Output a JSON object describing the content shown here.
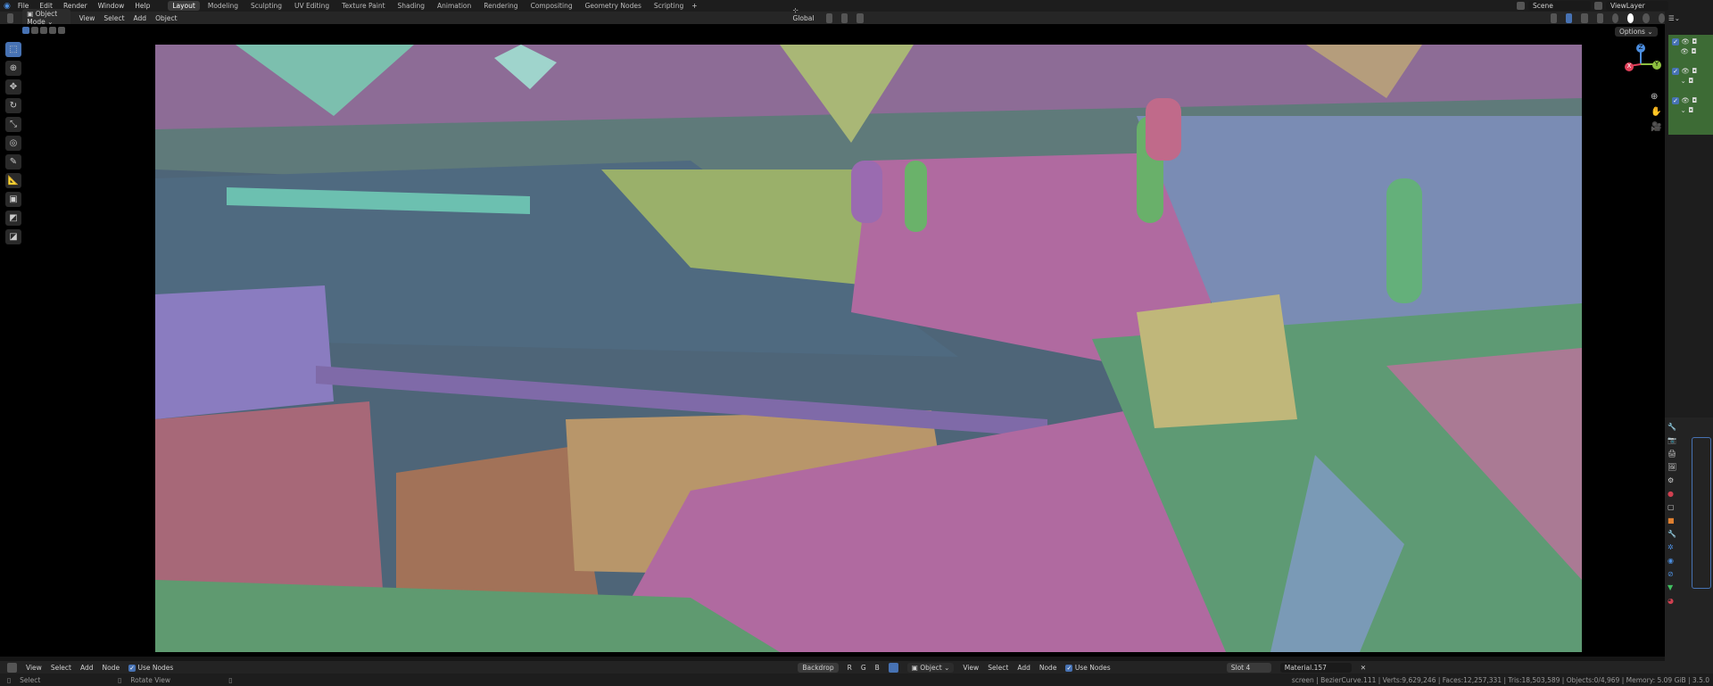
{
  "menu": [
    "File",
    "Edit",
    "Render",
    "Window",
    "Help"
  ],
  "workspaces": [
    "Layout",
    "Modeling",
    "Sculpting",
    "UV Editing",
    "Texture Paint",
    "Shading",
    "Animation",
    "Rendering",
    "Compositing",
    "Geometry Nodes",
    "Scripting"
  ],
  "active_workspace": "Layout",
  "scene": "Scene",
  "view_layer": "ViewLayer",
  "viewport_header": {
    "mode": "Object Mode",
    "menus": [
      "View",
      "Select",
      "Add",
      "Object"
    ],
    "orientation": "Global",
    "options": "Options"
  },
  "gizmo": {
    "x": "X",
    "y": "Y",
    "z": "Z"
  },
  "node_header": {
    "menus": [
      "View",
      "Select",
      "Add",
      "Node"
    ],
    "use_nodes": "Use Nodes",
    "backdrop": "Backdrop",
    "channels": [
      "R",
      "G",
      "B"
    ],
    "object": "Object",
    "menus2": [
      "View",
      "Select",
      "Add",
      "Node"
    ],
    "use_nodes2": "Use Nodes",
    "slot": "Slot 4",
    "material": "Material.157"
  },
  "status": {
    "select": "Select",
    "rotate": "Rotate View",
    "stats": "screen | BezierCurve.111 | Verts:9,629,246 | Faces:12,257,331 | Tris:18,503,589 | Objects:0/4,969 | Memory: 5.09 GiB | 3.5.0"
  },
  "colors": {
    "accent": "#4772b3",
    "outliner_bg": "#3d6b35",
    "sky": "#8a6a94",
    "water": "#4f6a80"
  }
}
